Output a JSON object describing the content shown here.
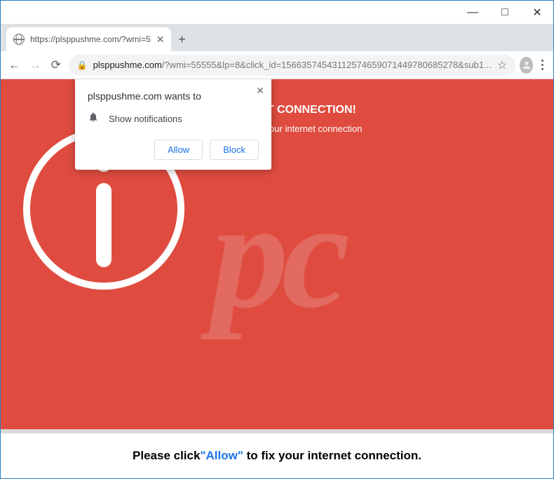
{
  "window": {
    "minimize": "—",
    "maximize": "□",
    "close": "✕"
  },
  "tab": {
    "title": "https://plsppushme.com/?wmi=5",
    "close": "✕"
  },
  "newtab": "+",
  "toolbar": {
    "back": "←",
    "forward": "→",
    "reload": "⟳",
    "lock": "🔒",
    "url_domain": "plsppushme.com",
    "url_rest": "/?wmi=55555&lp=8&click_id=15663574543112574659071449780685278&sub1...",
    "star": "☆"
  },
  "page": {
    "heading": "NO INTERNET CONNECTION!",
    "subtext": "click \"Allow\" to fix your internet connection",
    "watermark": "pc",
    "footer_prefix": "Please click",
    "footer_blue": "\"Allow\"",
    "footer_suffix": " to fix your internet connection."
  },
  "permission": {
    "title": "plsppushme.com wants to",
    "label": "Show notifications",
    "allow": "Allow",
    "block": "Block",
    "close": "✕"
  }
}
